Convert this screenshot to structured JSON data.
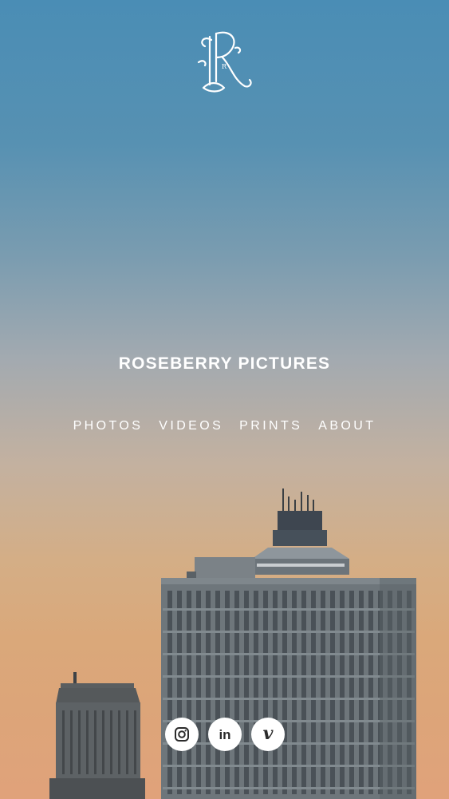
{
  "brand": {
    "logo_letter": "R",
    "site_title": "ROSEBERRY PICTURES"
  },
  "nav": {
    "items": [
      {
        "label": "PHOTOS"
      },
      {
        "label": "VIDEOS"
      },
      {
        "label": "PRINTS"
      },
      {
        "label": "ABOUT"
      }
    ]
  },
  "social": {
    "icons": [
      "instagram-icon",
      "linkedin-icon",
      "vimeo-icon"
    ],
    "linkedin_text": "in",
    "vimeo_text": "v"
  },
  "colors": {
    "sky_top": "#4a8db5",
    "sky_bottom": "#e0a27a",
    "text": "#ffffff",
    "icon_bg": "#ffffff",
    "icon_fg": "#2b2b2b"
  }
}
